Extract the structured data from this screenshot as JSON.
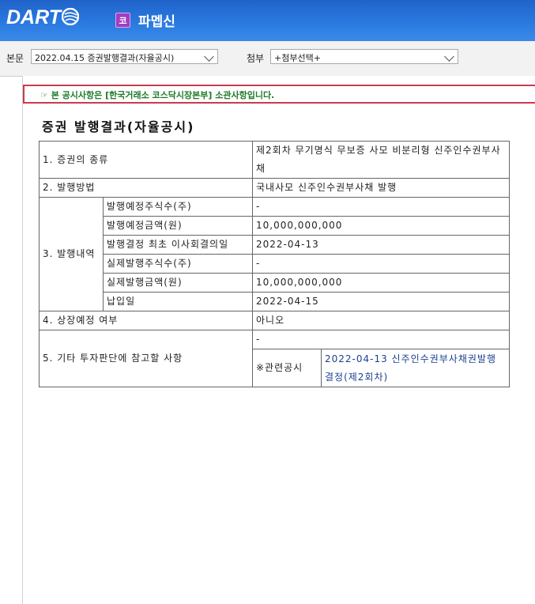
{
  "header": {
    "logo_text": "DART",
    "market_badge": "코",
    "company_name": "파멥신"
  },
  "toolbar": {
    "main_label": "본문",
    "main_select_value": "2022.04.15  증권발행결과(자율공시)",
    "attach_label": "첨부",
    "attach_select_value": "+첨부선택+"
  },
  "notice": {
    "text": "☞ 본 공시사항은 [한국거래소 코스닥시장본부] 소관사항입니다."
  },
  "document": {
    "title": "증권  발행결과(자율공시)",
    "rows": {
      "r1_label": "1. 증권의 종류",
      "r1_value": "제2회차 무기명식 무보증 사모 비분리형 신주인수권부사채",
      "r2_label": "2. 발행방법",
      "r2_value": "국내사모 신주인수권부사채 발행",
      "r3_label": "3. 발행내역",
      "r3_sub": [
        {
          "label": "발행예정주식수(주)",
          "value": "-"
        },
        {
          "label": "발행예정금액(원)",
          "value": "10,000,000,000"
        },
        {
          "label": "발행결정 최초 이사회결의일",
          "value": "2022-04-13"
        },
        {
          "label": "실제발행주식수(주)",
          "value": "-"
        },
        {
          "label": "실제발행금액(원)",
          "value": "10,000,000,000"
        },
        {
          "label": "납입일",
          "value": "2022-04-15"
        }
      ],
      "r4_label": "4. 상장예정 여부",
      "r4_value": "아니오",
      "r5_label": "5. 기타 투자판단에 참고할 사항",
      "r5_value": "-",
      "r5_related_label": "※관련공시",
      "r5_related_link": "2022-04-13 신주인수권부사채권발행결정(제2회차)"
    }
  }
}
